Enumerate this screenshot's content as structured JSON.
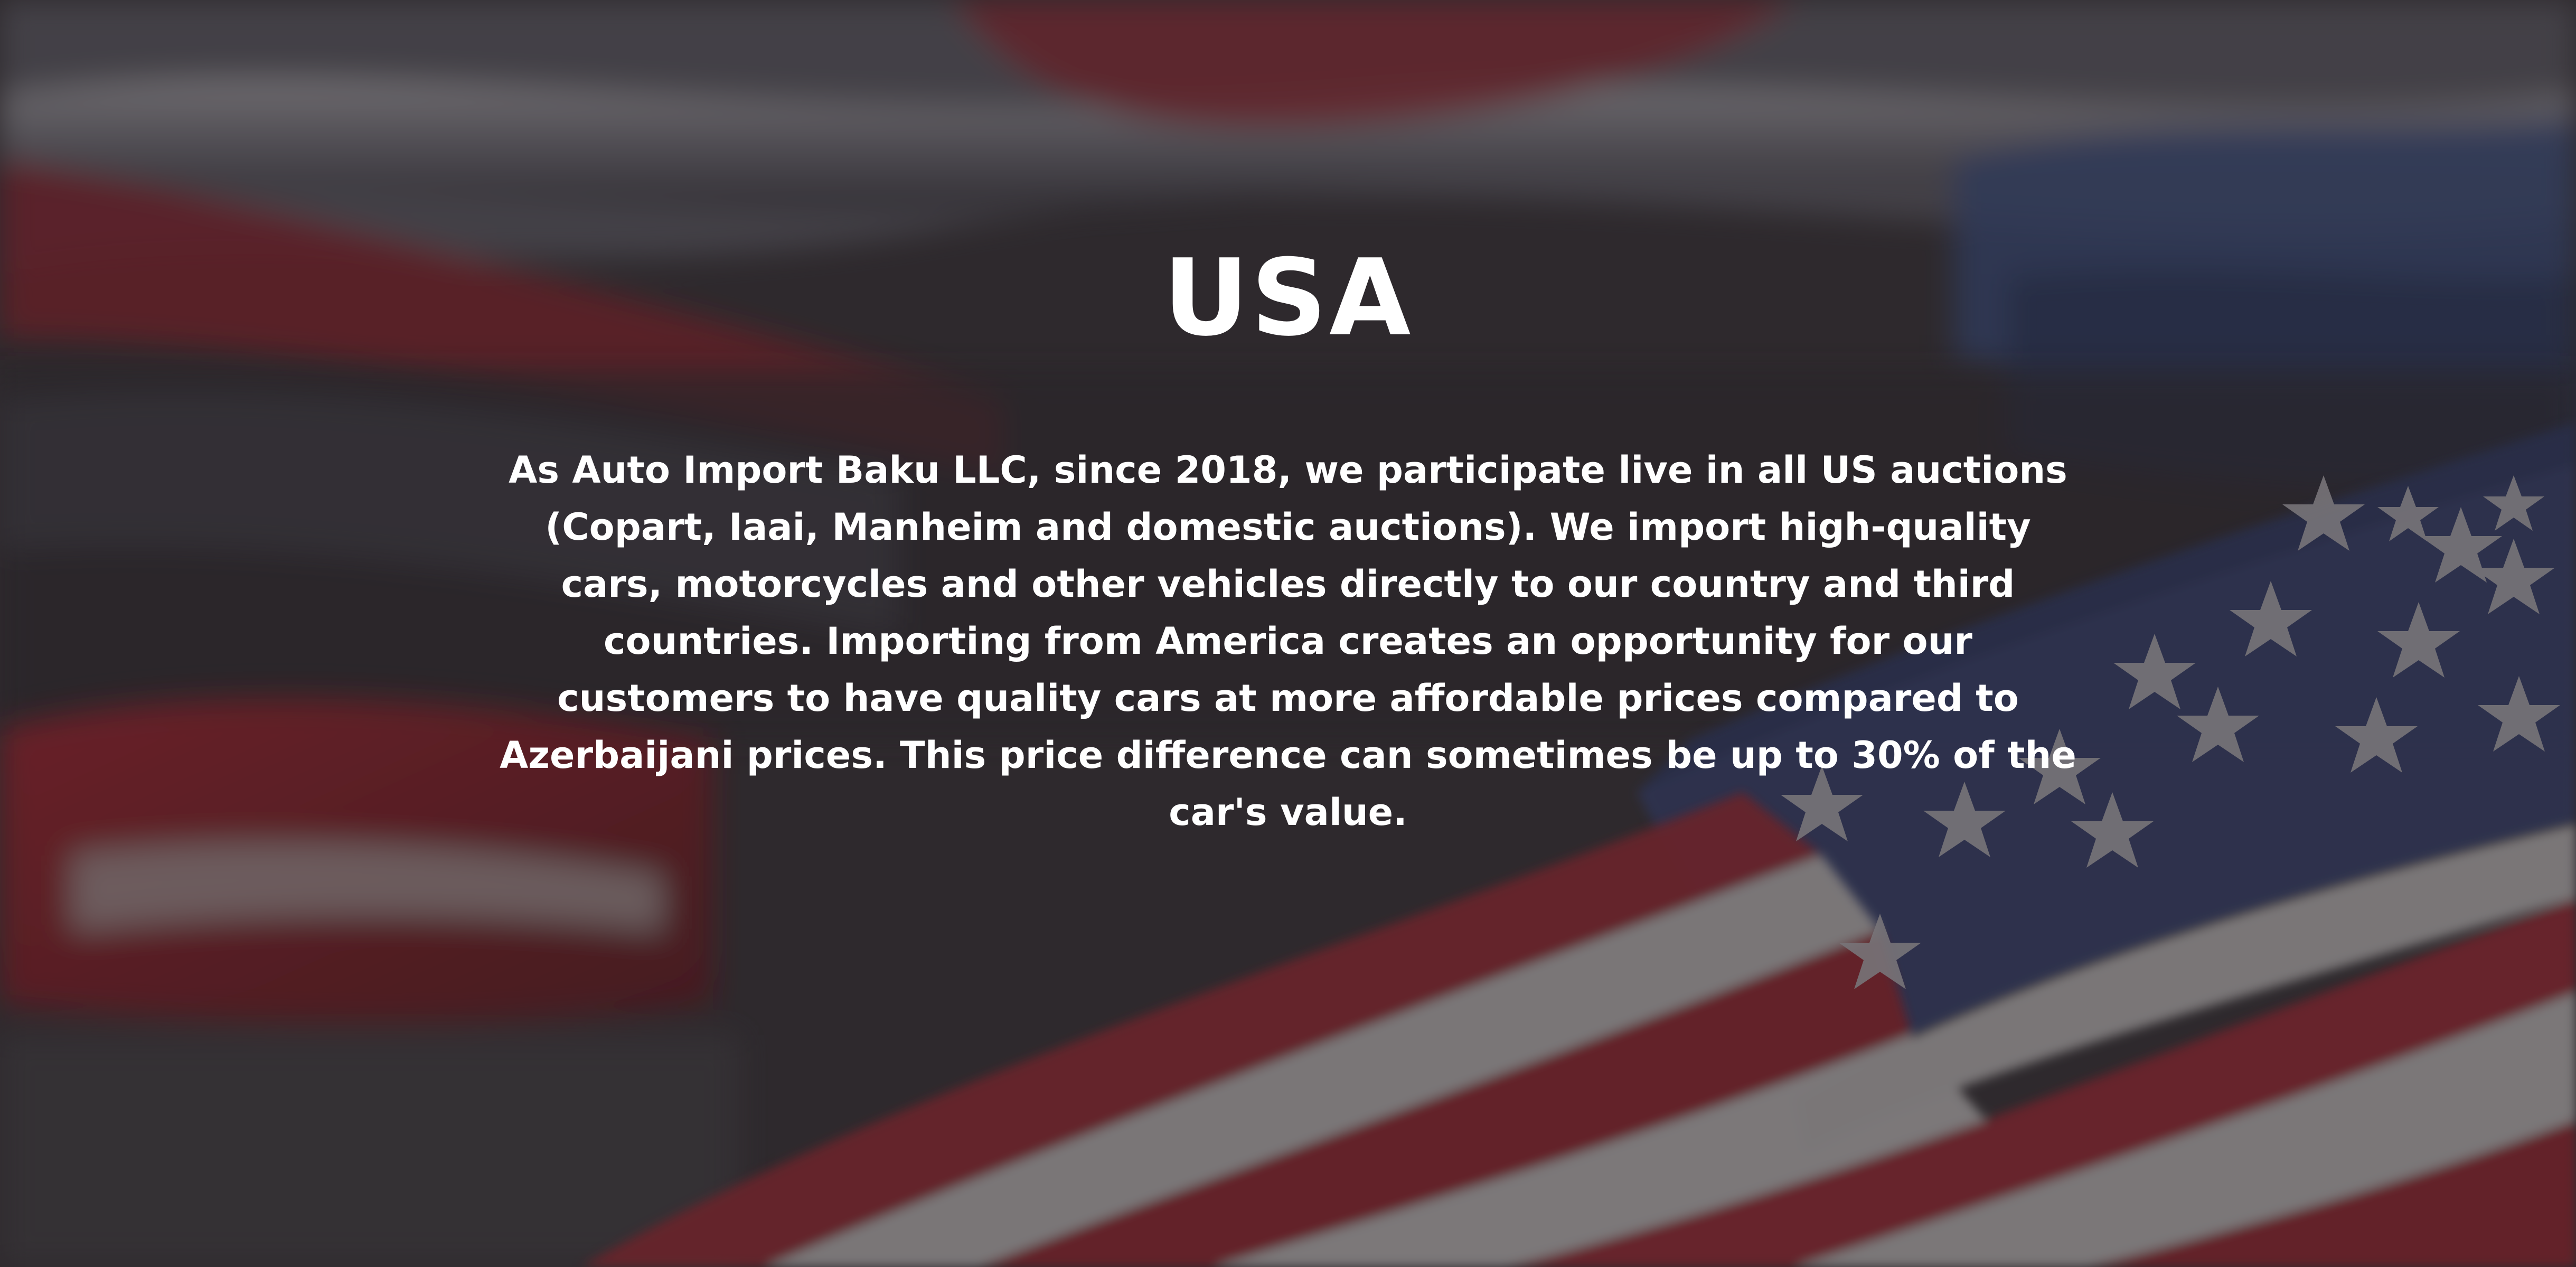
{
  "hero": {
    "title": "USA",
    "description": "As Auto Import Baku LLC, since 2018, we participate live in all US auctions (Copart, Iaai, Manheim and domestic auctions). We import high-quality cars, motorcycles and other vehicles directly to our country and third countries. Importing from America creates an opportunity for our customers to have quality cars at more affordable prices compared to Azerbaijani prices. This price difference can sometimes be up to 30% of the car's value."
  },
  "colors": {
    "text": "#ffffff",
    "flag_red": "#b3222e",
    "flag_blue": "#2a3a6e",
    "flag_white": "#f4f1f0",
    "overlay": "#262226"
  },
  "background": {
    "subject": "blurred-cars-with-american-flag"
  }
}
